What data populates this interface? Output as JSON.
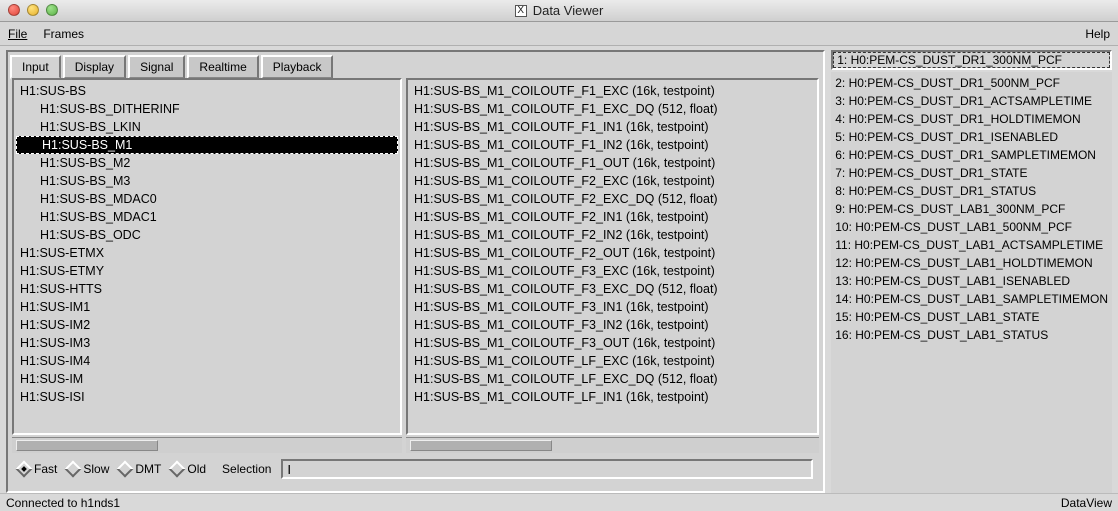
{
  "window": {
    "title": "Data Viewer"
  },
  "menu": {
    "file": "File",
    "frames": "Frames",
    "help": "Help"
  },
  "tabs": [
    "Input",
    "Display",
    "Signal",
    "Realtime",
    "Playback"
  ],
  "active_tab": 0,
  "left_list": {
    "selected_index": 3,
    "items": [
      {
        "text": "H1:SUS-BS",
        "indent": 0
      },
      {
        "text": "H1:SUS-BS_DITHERINF",
        "indent": 1
      },
      {
        "text": "H1:SUS-BS_LKIN",
        "indent": 1
      },
      {
        "text": "H1:SUS-BS_M1",
        "indent": 1
      },
      {
        "text": "H1:SUS-BS_M2",
        "indent": 1
      },
      {
        "text": "H1:SUS-BS_M3",
        "indent": 1
      },
      {
        "text": "H1:SUS-BS_MDAC0",
        "indent": 1
      },
      {
        "text": "H1:SUS-BS_MDAC1",
        "indent": 1
      },
      {
        "text": "H1:SUS-BS_ODC",
        "indent": 1
      },
      {
        "text": "H1:SUS-ETMX",
        "indent": 0
      },
      {
        "text": "H1:SUS-ETMY",
        "indent": 0
      },
      {
        "text": "H1:SUS-HTTS",
        "indent": 0
      },
      {
        "text": "H1:SUS-IM1",
        "indent": 0
      },
      {
        "text": "H1:SUS-IM2",
        "indent": 0
      },
      {
        "text": "H1:SUS-IM3",
        "indent": 0
      },
      {
        "text": "H1:SUS-IM4",
        "indent": 0
      },
      {
        "text": "H1:SUS-IM",
        "indent": 0
      },
      {
        "text": "H1:SUS-ISI",
        "indent": 0
      }
    ]
  },
  "middle_list": {
    "items": [
      {
        "text": "H1:SUS-BS_M1_COILOUTF_F1_EXC   (16k, testpoint)"
      },
      {
        "text": "H1:SUS-BS_M1_COILOUTF_F1_EXC_DQ   (512, float)"
      },
      {
        "text": "H1:SUS-BS_M1_COILOUTF_F1_IN1   (16k, testpoint)"
      },
      {
        "text": "H1:SUS-BS_M1_COILOUTF_F1_IN2   (16k, testpoint)"
      },
      {
        "text": "H1:SUS-BS_M1_COILOUTF_F1_OUT   (16k, testpoint)"
      },
      {
        "text": "H1:SUS-BS_M1_COILOUTF_F2_EXC   (16k, testpoint)"
      },
      {
        "text": "H1:SUS-BS_M1_COILOUTF_F2_EXC_DQ   (512, float)"
      },
      {
        "text": "H1:SUS-BS_M1_COILOUTF_F2_IN1   (16k, testpoint)"
      },
      {
        "text": "H1:SUS-BS_M1_COILOUTF_F2_IN2   (16k, testpoint)"
      },
      {
        "text": "H1:SUS-BS_M1_COILOUTF_F2_OUT   (16k, testpoint)"
      },
      {
        "text": "H1:SUS-BS_M1_COILOUTF_F3_EXC   (16k, testpoint)"
      },
      {
        "text": "H1:SUS-BS_M1_COILOUTF_F3_EXC_DQ   (512, float)"
      },
      {
        "text": "H1:SUS-BS_M1_COILOUTF_F3_IN1   (16k, testpoint)"
      },
      {
        "text": "H1:SUS-BS_M1_COILOUTF_F3_IN2   (16k, testpoint)"
      },
      {
        "text": "H1:SUS-BS_M1_COILOUTF_F3_OUT   (16k, testpoint)"
      },
      {
        "text": "H1:SUS-BS_M1_COILOUTF_LF_EXC   (16k, testpoint)"
      },
      {
        "text": "H1:SUS-BS_M1_COILOUTF_LF_EXC_DQ   (512, float)"
      },
      {
        "text": "H1:SUS-BS_M1_COILOUTF_LF_IN1   (16k, testpoint)"
      }
    ]
  },
  "radios": [
    {
      "label": "Fast",
      "checked": true
    },
    {
      "label": "Slow",
      "checked": false
    },
    {
      "label": "DMT",
      "checked": false
    },
    {
      "label": "Old",
      "checked": false
    }
  ],
  "selection_label": "Selection",
  "selection_value": "I",
  "right": {
    "selected": "1: H0:PEM-CS_DUST_DR1_300NM_PCF",
    "items": [
      "2: H0:PEM-CS_DUST_DR1_500NM_PCF",
      "3: H0:PEM-CS_DUST_DR1_ACTSAMPLETIME",
      "4: H0:PEM-CS_DUST_DR1_HOLDTIMEMON",
      "5: H0:PEM-CS_DUST_DR1_ISENABLED",
      "6: H0:PEM-CS_DUST_DR1_SAMPLETIMEMON",
      "7: H0:PEM-CS_DUST_DR1_STATE",
      "8: H0:PEM-CS_DUST_DR1_STATUS",
      "9: H0:PEM-CS_DUST_LAB1_300NM_PCF",
      "10: H0:PEM-CS_DUST_LAB1_500NM_PCF",
      "11: H0:PEM-CS_DUST_LAB1_ACTSAMPLETIME",
      "12: H0:PEM-CS_DUST_LAB1_HOLDTIMEMON",
      "13: H0:PEM-CS_DUST_LAB1_ISENABLED",
      "14: H0:PEM-CS_DUST_LAB1_SAMPLETIMEMON",
      "15: H0:PEM-CS_DUST_LAB1_STATE",
      "16: H0:PEM-CS_DUST_LAB1_STATUS"
    ]
  },
  "status": {
    "left": "Connected to h1nds1",
    "right": "DataView"
  }
}
